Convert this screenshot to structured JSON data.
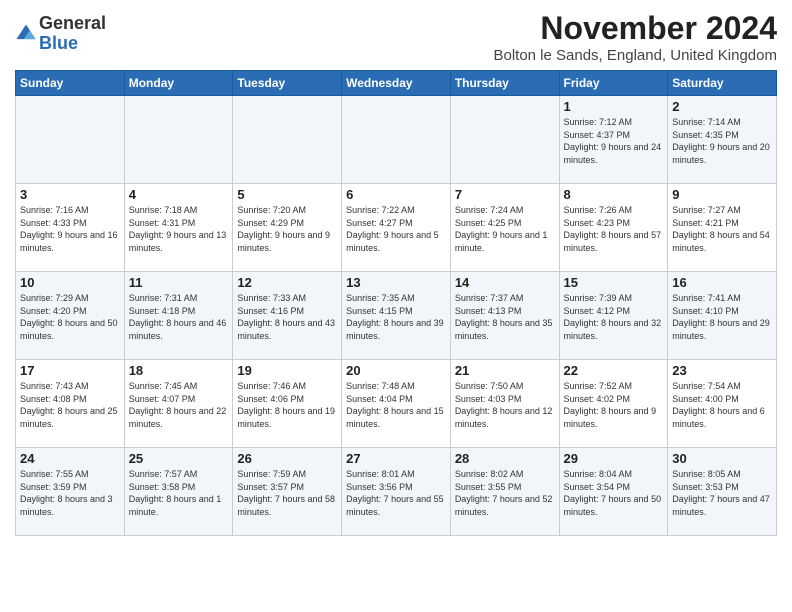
{
  "logo": {
    "general": "General",
    "blue": "Blue"
  },
  "title": "November 2024",
  "location": "Bolton le Sands, England, United Kingdom",
  "weekdays": [
    "Sunday",
    "Monday",
    "Tuesday",
    "Wednesday",
    "Thursday",
    "Friday",
    "Saturday"
  ],
  "weeks": [
    [
      {
        "day": "",
        "info": ""
      },
      {
        "day": "",
        "info": ""
      },
      {
        "day": "",
        "info": ""
      },
      {
        "day": "",
        "info": ""
      },
      {
        "day": "",
        "info": ""
      },
      {
        "day": "1",
        "info": "Sunrise: 7:12 AM\nSunset: 4:37 PM\nDaylight: 9 hours\nand 24 minutes."
      },
      {
        "day": "2",
        "info": "Sunrise: 7:14 AM\nSunset: 4:35 PM\nDaylight: 9 hours\nand 20 minutes."
      }
    ],
    [
      {
        "day": "3",
        "info": "Sunrise: 7:16 AM\nSunset: 4:33 PM\nDaylight: 9 hours\nand 16 minutes."
      },
      {
        "day": "4",
        "info": "Sunrise: 7:18 AM\nSunset: 4:31 PM\nDaylight: 9 hours\nand 13 minutes."
      },
      {
        "day": "5",
        "info": "Sunrise: 7:20 AM\nSunset: 4:29 PM\nDaylight: 9 hours\nand 9 minutes."
      },
      {
        "day": "6",
        "info": "Sunrise: 7:22 AM\nSunset: 4:27 PM\nDaylight: 9 hours\nand 5 minutes."
      },
      {
        "day": "7",
        "info": "Sunrise: 7:24 AM\nSunset: 4:25 PM\nDaylight: 9 hours\nand 1 minute."
      },
      {
        "day": "8",
        "info": "Sunrise: 7:26 AM\nSunset: 4:23 PM\nDaylight: 8 hours\nand 57 minutes."
      },
      {
        "day": "9",
        "info": "Sunrise: 7:27 AM\nSunset: 4:21 PM\nDaylight: 8 hours\nand 54 minutes."
      }
    ],
    [
      {
        "day": "10",
        "info": "Sunrise: 7:29 AM\nSunset: 4:20 PM\nDaylight: 8 hours\nand 50 minutes."
      },
      {
        "day": "11",
        "info": "Sunrise: 7:31 AM\nSunset: 4:18 PM\nDaylight: 8 hours\nand 46 minutes."
      },
      {
        "day": "12",
        "info": "Sunrise: 7:33 AM\nSunset: 4:16 PM\nDaylight: 8 hours\nand 43 minutes."
      },
      {
        "day": "13",
        "info": "Sunrise: 7:35 AM\nSunset: 4:15 PM\nDaylight: 8 hours\nand 39 minutes."
      },
      {
        "day": "14",
        "info": "Sunrise: 7:37 AM\nSunset: 4:13 PM\nDaylight: 8 hours\nand 35 minutes."
      },
      {
        "day": "15",
        "info": "Sunrise: 7:39 AM\nSunset: 4:12 PM\nDaylight: 8 hours\nand 32 minutes."
      },
      {
        "day": "16",
        "info": "Sunrise: 7:41 AM\nSunset: 4:10 PM\nDaylight: 8 hours\nand 29 minutes."
      }
    ],
    [
      {
        "day": "17",
        "info": "Sunrise: 7:43 AM\nSunset: 4:08 PM\nDaylight: 8 hours\nand 25 minutes."
      },
      {
        "day": "18",
        "info": "Sunrise: 7:45 AM\nSunset: 4:07 PM\nDaylight: 8 hours\nand 22 minutes."
      },
      {
        "day": "19",
        "info": "Sunrise: 7:46 AM\nSunset: 4:06 PM\nDaylight: 8 hours\nand 19 minutes."
      },
      {
        "day": "20",
        "info": "Sunrise: 7:48 AM\nSunset: 4:04 PM\nDaylight: 8 hours\nand 15 minutes."
      },
      {
        "day": "21",
        "info": "Sunrise: 7:50 AM\nSunset: 4:03 PM\nDaylight: 8 hours\nand 12 minutes."
      },
      {
        "day": "22",
        "info": "Sunrise: 7:52 AM\nSunset: 4:02 PM\nDaylight: 8 hours\nand 9 minutes."
      },
      {
        "day": "23",
        "info": "Sunrise: 7:54 AM\nSunset: 4:00 PM\nDaylight: 8 hours\nand 6 minutes."
      }
    ],
    [
      {
        "day": "24",
        "info": "Sunrise: 7:55 AM\nSunset: 3:59 PM\nDaylight: 8 hours\nand 3 minutes."
      },
      {
        "day": "25",
        "info": "Sunrise: 7:57 AM\nSunset: 3:58 PM\nDaylight: 8 hours\nand 1 minute."
      },
      {
        "day": "26",
        "info": "Sunrise: 7:59 AM\nSunset: 3:57 PM\nDaylight: 7 hours\nand 58 minutes."
      },
      {
        "day": "27",
        "info": "Sunrise: 8:01 AM\nSunset: 3:56 PM\nDaylight: 7 hours\nand 55 minutes."
      },
      {
        "day": "28",
        "info": "Sunrise: 8:02 AM\nSunset: 3:55 PM\nDaylight: 7 hours\nand 52 minutes."
      },
      {
        "day": "29",
        "info": "Sunrise: 8:04 AM\nSunset: 3:54 PM\nDaylight: 7 hours\nand 50 minutes."
      },
      {
        "day": "30",
        "info": "Sunrise: 8:05 AM\nSunset: 3:53 PM\nDaylight: 7 hours\nand 47 minutes."
      }
    ]
  ]
}
